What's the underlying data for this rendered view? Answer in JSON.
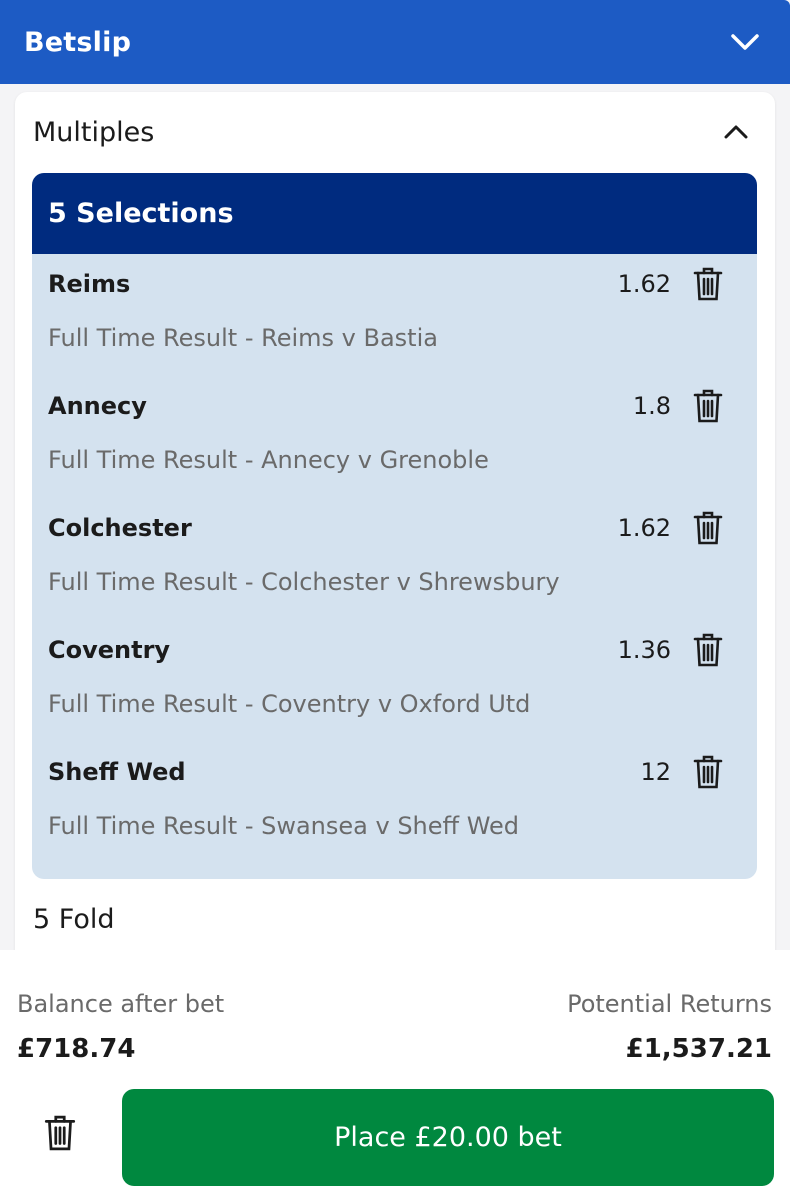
{
  "header": {
    "title": "Betslip",
    "collapse_icon": "chevron-down-icon"
  },
  "multiples": {
    "title": "Multiples",
    "toggle_icon": "chevron-up-icon",
    "selections_heading": "5 Selections",
    "selections": [
      {
        "team": "Reims",
        "odds": "1.62",
        "market": "Full Time Result - Reims v Bastia"
      },
      {
        "team": "Annecy",
        "odds": "1.8",
        "market": "Full Time Result - Annecy v Grenoble"
      },
      {
        "team": "Colchester",
        "odds": "1.62",
        "market": "Full Time Result - Colchester v Shrewsbury"
      },
      {
        "team": "Coventry",
        "odds": "1.36",
        "market": "Full Time Result - Coventry v Oxford Utd"
      },
      {
        "team": "Sheff Wed",
        "odds": "12",
        "market": "Full Time Result - Swansea v Sheff Wed"
      }
    ],
    "fold_label": "5 Fold"
  },
  "footer": {
    "balance_label": "Balance after bet",
    "balance_value": "£718.74",
    "returns_label": "Potential Returns",
    "returns_value": "£1,537.21",
    "place_button_label": "Place £20.00 bet",
    "clear_icon": "trash-icon"
  },
  "colors": {
    "header_bg": "#1d5bc4",
    "selections_header_bg": "#002b7f",
    "selections_bg": "#d4e2ef",
    "place_button_bg": "#00883f"
  }
}
